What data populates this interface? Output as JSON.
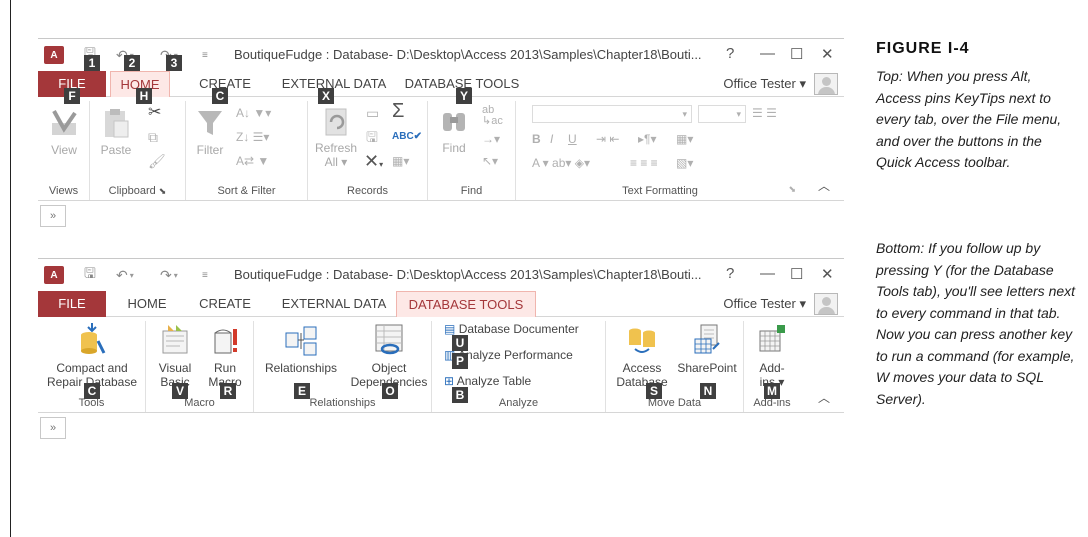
{
  "figure": {
    "label": "FIGURE I-4",
    "caption_top": "Top: When you press Alt, Access pins KeyTips next to every tab, over the File menu, and over the buttons in the Quick Access toolbar.",
    "caption_bottom": "Bottom: If you follow up by pressing Y (for the Database Tools tab), you'll see letters next to every command in that tab. Now you can press another key to run a command (for example, W moves your data to SQL Server)."
  },
  "window": {
    "app_icon": "A",
    "title": "BoutiqueFudge : Database- D:\\Desktop\\Access 2013\\Samples\\Chapter18\\Bouti...",
    "help": "?",
    "minimize": "—",
    "maximize": "☐",
    "close": "✕",
    "user": "Office Tester ▾",
    "nav_toggle": "»"
  },
  "tabs": [
    "FILE",
    "HOME",
    "CREATE",
    "EXTERNAL DATA",
    "DATABASE TOOLS"
  ],
  "top": {
    "active_tab": "HOME",
    "keytips": {
      "qa_save": "1",
      "qa_undo": "2",
      "qa_redo": "3",
      "file": "F",
      "home": "H",
      "create": "C",
      "external": "X",
      "dbtools": "Y"
    },
    "groups": {
      "views": "Views",
      "clipboard": "Clipboard",
      "sort": "Sort & Filter",
      "records": "Records",
      "find": "Find",
      "text": "Text Formatting"
    },
    "commands": {
      "view": "View",
      "paste": "Paste",
      "filter": "Filter",
      "refresh": "Refresh",
      "refresh2": "All ▾",
      "find": "Find"
    }
  },
  "bottom": {
    "active_tab": "DATABASE TOOLS",
    "groups": {
      "tools": "Tools",
      "macro": "Macro",
      "relationships": "Relationships",
      "analyze": "Analyze",
      "move": "Move Data",
      "addins": "Add-ins"
    },
    "commands": {
      "compact1": "Compact and",
      "compact2": "Repair Database",
      "vb1": "Visual",
      "vb2": "Basic",
      "run1": "Run",
      "run2": "Macro",
      "rel": "Relationships",
      "dep1": "Object",
      "dep2": "Dependencies",
      "documenter": "Database Documenter",
      "perf": "Analyze Performance",
      "table": "Analyze Table",
      "access1": "Access",
      "access2": "Database",
      "sharepoint": "SharePoint",
      "addins1": "Add-",
      "addins2": "ins ▾"
    },
    "keytips": {
      "compact": "C",
      "vb": "V",
      "run": "R",
      "rel": "E",
      "dep": "O",
      "documenter": "U",
      "perf": "P",
      "table": "B",
      "access": "S",
      "sharepoint": "N",
      "addins": "M"
    }
  },
  "colors": {
    "accent": "#a4373a",
    "active_tab_bg": "#fde8e6",
    "keytip_bg": "#3f3f3f"
  }
}
